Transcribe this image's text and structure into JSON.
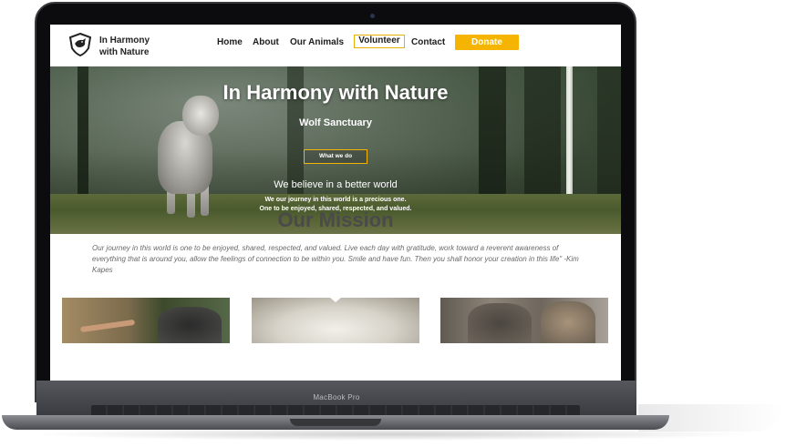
{
  "device": {
    "label": "MacBook Pro"
  },
  "site": {
    "logo": {
      "icon": "wolf-shield-icon",
      "line1": "In Harmony",
      "line2": "with Nature"
    },
    "nav": {
      "home": "Home",
      "about": "About",
      "animals": "Our Animals",
      "volunteer": "Volunteer",
      "contact": "Contact",
      "donate": "Donate"
    },
    "hero": {
      "title": "In Harmony with Nature",
      "subtitle": "Wolf Sanctuary",
      "button": "What we do",
      "believe": "We believe in a better world",
      "journey_line1": "We our journey in this world is a precious one.",
      "journey_line2": "One to be enjoyed, shared, respected, and valued."
    },
    "mission": {
      "title": "Our Mission",
      "quote": "Our journey in this world is one to be enjoyed, shared, respected, and valued. Live each day with gratitude, work toward a reverent awareness of everything that is around you, allow the feelings of connection to be within you. Smile and have fun. Then you shall honor your creation in this life\"  -Kim Kapes"
    },
    "colors": {
      "accent": "#f4b400",
      "heading": "#4a4a4a"
    }
  }
}
